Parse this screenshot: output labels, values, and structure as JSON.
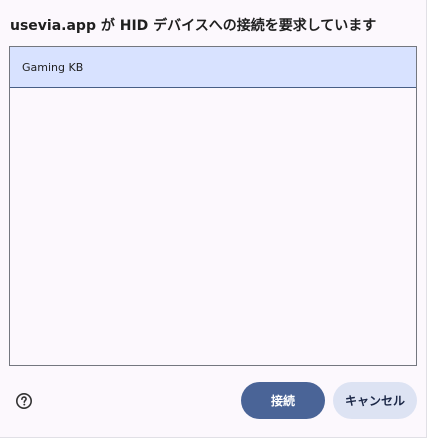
{
  "dialog": {
    "title": "usevia.app が HID デバイスへの接続を要求しています",
    "devices": [
      {
        "label": "Gaming KB",
        "selected": true
      }
    ],
    "help_icon": "help-circle-icon",
    "connect_label": "接続",
    "cancel_label": "キャンセル"
  },
  "colors": {
    "dialog_background": "#fcf8fd",
    "selected_item": "#d8e2ff",
    "selected_underline": "#485f86",
    "primary_button": "#4a6497",
    "secondary_button": "#dde3f3"
  }
}
